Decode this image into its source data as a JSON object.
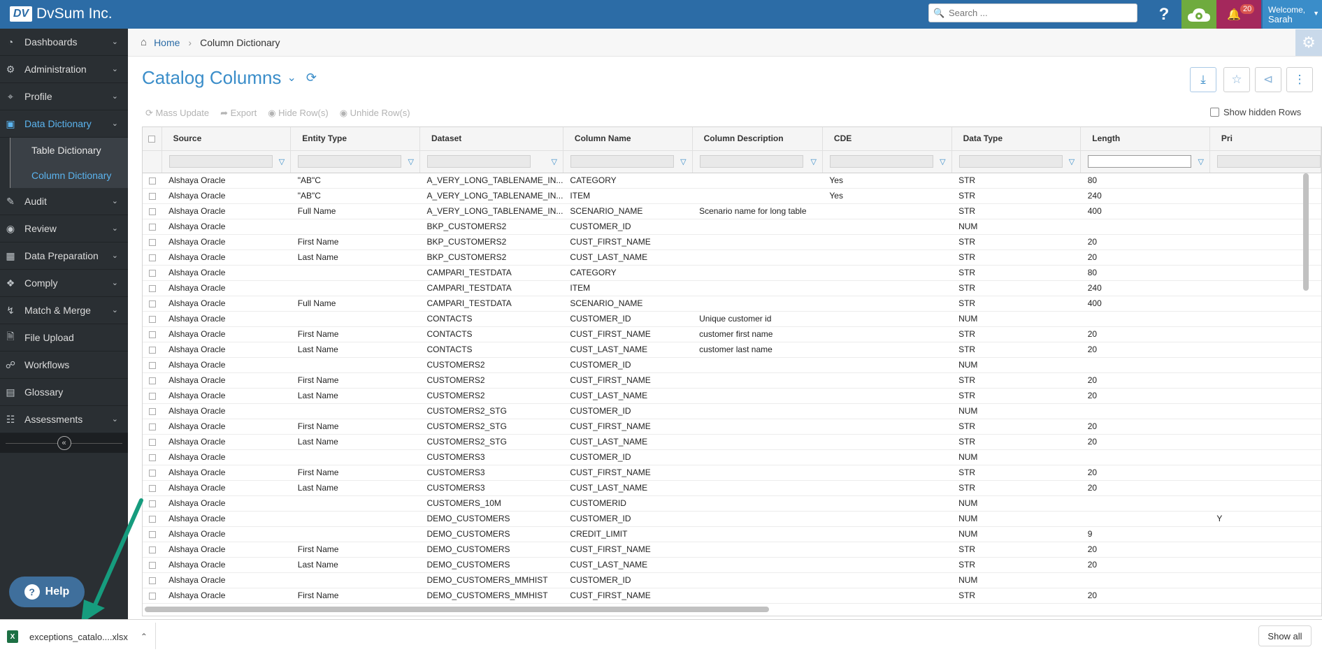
{
  "app": {
    "brand": "DvSum Inc.",
    "logo_text": "DV"
  },
  "header": {
    "search_placeholder": "Search ...",
    "help_label": "?",
    "notification_count": "20",
    "welcome_label": "Welcome,",
    "user_name": "Sarah"
  },
  "sidebar": {
    "items": [
      {
        "label": "Dashboards",
        "icon": "dashboard-icon",
        "chevron": true
      },
      {
        "label": "Administration",
        "icon": "cogs-icon",
        "chevron": true
      },
      {
        "label": "Profile",
        "icon": "crosshair-icon",
        "chevron": true
      },
      {
        "label": "Data Dictionary",
        "icon": "dictionary-icon",
        "chevron": true,
        "active": true
      },
      {
        "label": "Audit",
        "icon": "edit-icon",
        "chevron": true
      },
      {
        "label": "Review",
        "icon": "eye-icon",
        "chevron": true
      },
      {
        "label": "Data Preparation",
        "icon": "data-prep-icon",
        "chevron": true
      },
      {
        "label": "Comply",
        "icon": "tags-icon",
        "chevron": true
      },
      {
        "label": "Match & Merge",
        "icon": "merge-icon",
        "chevron": true
      },
      {
        "label": "File Upload",
        "icon": "file-icon",
        "chevron": false
      },
      {
        "label": "Workflows",
        "icon": "workflow-icon",
        "chevron": false
      },
      {
        "label": "Glossary",
        "icon": "glossary-icon",
        "chevron": false
      },
      {
        "label": "Assessments",
        "icon": "assessment-icon",
        "chevron": true
      }
    ],
    "subitems": [
      "Table Dictionary",
      "Column Dictionary"
    ],
    "help_label": "Help"
  },
  "breadcrumb": {
    "home": "Home",
    "current": "Column Dictionary"
  },
  "page": {
    "title": "Catalog Columns"
  },
  "toolbar": {
    "mass_update": "Mass Update",
    "export": "Export",
    "hide_rows": "Hide Row(s)",
    "unhide_rows": "Unhide Row(s)",
    "show_hidden": "Show hidden Rows"
  },
  "table": {
    "columns": [
      "Source",
      "Entity Type",
      "Dataset",
      "Column Name",
      "Column Description",
      "CDE",
      "Data Type",
      "Length",
      "Pri"
    ],
    "rows": [
      [
        "Alshaya Oracle",
        "\"AB\"C",
        "A_VERY_LONG_TABLENAME_IN...",
        "CATEGORY",
        "",
        "Yes",
        "STR",
        "80",
        ""
      ],
      [
        "Alshaya Oracle",
        "\"AB\"C",
        "A_VERY_LONG_TABLENAME_IN...",
        "ITEM",
        "",
        "Yes",
        "STR",
        "240",
        ""
      ],
      [
        "Alshaya Oracle",
        "Full Name",
        "A_VERY_LONG_TABLENAME_IN...",
        "SCENARIO_NAME",
        "Scenario name for long table",
        "",
        "STR",
        "400",
        ""
      ],
      [
        "Alshaya Oracle",
        "",
        "BKP_CUSTOMERS2",
        "CUSTOMER_ID",
        "",
        "",
        "NUM",
        "",
        ""
      ],
      [
        "Alshaya Oracle",
        "First Name",
        "BKP_CUSTOMERS2",
        "CUST_FIRST_NAME",
        "",
        "",
        "STR",
        "20",
        ""
      ],
      [
        "Alshaya Oracle",
        "Last Name",
        "BKP_CUSTOMERS2",
        "CUST_LAST_NAME",
        "",
        "",
        "STR",
        "20",
        ""
      ],
      [
        "Alshaya Oracle",
        "",
        "CAMPARI_TESTDATA",
        "CATEGORY",
        "",
        "",
        "STR",
        "80",
        ""
      ],
      [
        "Alshaya Oracle",
        "",
        "CAMPARI_TESTDATA",
        "ITEM",
        "",
        "",
        "STR",
        "240",
        ""
      ],
      [
        "Alshaya Oracle",
        "Full Name",
        "CAMPARI_TESTDATA",
        "SCENARIO_NAME",
        "",
        "",
        "STR",
        "400",
        ""
      ],
      [
        "Alshaya Oracle",
        "",
        "CONTACTS",
        "CUSTOMER_ID",
        "Unique customer id",
        "",
        "NUM",
        "",
        ""
      ],
      [
        "Alshaya Oracle",
        "First Name",
        "CONTACTS",
        "CUST_FIRST_NAME",
        "customer first name",
        "",
        "STR",
        "20",
        ""
      ],
      [
        "Alshaya Oracle",
        "Last Name",
        "CONTACTS",
        "CUST_LAST_NAME",
        "customer last name",
        "",
        "STR",
        "20",
        ""
      ],
      [
        "Alshaya Oracle",
        "",
        "CUSTOMERS2",
        "CUSTOMER_ID",
        "",
        "",
        "NUM",
        "",
        ""
      ],
      [
        "Alshaya Oracle",
        "First Name",
        "CUSTOMERS2",
        "CUST_FIRST_NAME",
        "",
        "",
        "STR",
        "20",
        ""
      ],
      [
        "Alshaya Oracle",
        "Last Name",
        "CUSTOMERS2",
        "CUST_LAST_NAME",
        "",
        "",
        "STR",
        "20",
        ""
      ],
      [
        "Alshaya Oracle",
        "",
        "CUSTOMERS2_STG",
        "CUSTOMER_ID",
        "",
        "",
        "NUM",
        "",
        ""
      ],
      [
        "Alshaya Oracle",
        "First Name",
        "CUSTOMERS2_STG",
        "CUST_FIRST_NAME",
        "",
        "",
        "STR",
        "20",
        ""
      ],
      [
        "Alshaya Oracle",
        "Last Name",
        "CUSTOMERS2_STG",
        "CUST_LAST_NAME",
        "",
        "",
        "STR",
        "20",
        ""
      ],
      [
        "Alshaya Oracle",
        "",
        "CUSTOMERS3",
        "CUSTOMER_ID",
        "",
        "",
        "NUM",
        "",
        ""
      ],
      [
        "Alshaya Oracle",
        "First Name",
        "CUSTOMERS3",
        "CUST_FIRST_NAME",
        "",
        "",
        "STR",
        "20",
        ""
      ],
      [
        "Alshaya Oracle",
        "Last Name",
        "CUSTOMERS3",
        "CUST_LAST_NAME",
        "",
        "",
        "STR",
        "20",
        ""
      ],
      [
        "Alshaya Oracle",
        "",
        "CUSTOMERS_10M",
        "CUSTOMERID",
        "",
        "",
        "NUM",
        "",
        ""
      ],
      [
        "Alshaya Oracle",
        "",
        "DEMO_CUSTOMERS",
        "CUSTOMER_ID",
        "",
        "",
        "NUM",
        "",
        "Y"
      ],
      [
        "Alshaya Oracle",
        "",
        "DEMO_CUSTOMERS",
        "CREDIT_LIMIT",
        "",
        "",
        "NUM",
        "9",
        ""
      ],
      [
        "Alshaya Oracle",
        "First Name",
        "DEMO_CUSTOMERS",
        "CUST_FIRST_NAME",
        "",
        "",
        "STR",
        "20",
        ""
      ],
      [
        "Alshaya Oracle",
        "Last Name",
        "DEMO_CUSTOMERS",
        "CUST_LAST_NAME",
        "",
        "",
        "STR",
        "20",
        ""
      ],
      [
        "Alshaya Oracle",
        "",
        "DEMO_CUSTOMERS_MMHIST",
        "CUSTOMER_ID",
        "",
        "",
        "NUM",
        "",
        ""
      ],
      [
        "Alshaya Oracle",
        "First Name",
        "DEMO_CUSTOMERS_MMHIST",
        "CUST_FIRST_NAME",
        "",
        "",
        "STR",
        "20",
        ""
      ]
    ]
  },
  "downloads": {
    "file_name": "exceptions_catalo....xlsx",
    "file_icon_text": "X",
    "show_all": "Show all"
  },
  "colors": {
    "topbar": "#2c6ca6",
    "sidebar": "#2a2f33",
    "accent": "#3a8dc9",
    "cloud": "#6fab3e",
    "bell": "#a4285c",
    "arrow": "#169c7e"
  }
}
